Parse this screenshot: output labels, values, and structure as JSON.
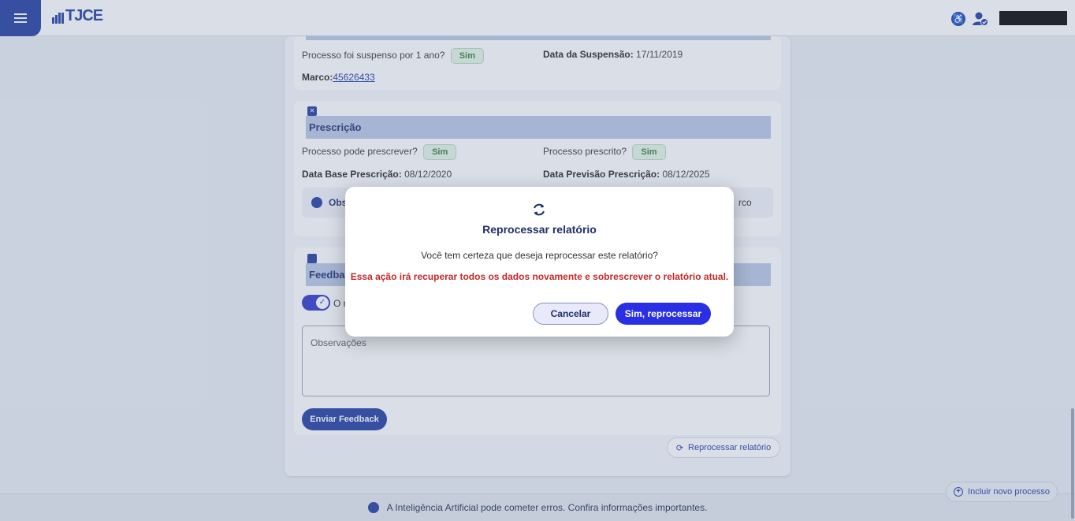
{
  "header": {
    "logo_text": "TJCE",
    "accessibility_icon": "accessibility-icon",
    "user_icon": "user-check-icon"
  },
  "suspension": {
    "suspended_label": "Processo foi suspenso por 1 ano?",
    "suspended_value": "Sim",
    "date_label": "Data da Suspensão:",
    "date_value": "17/11/2019",
    "marco_label": "Marco:",
    "marco_value": "45626433"
  },
  "prescricao": {
    "title": "Prescrição",
    "can_prescribe_label": "Processo pode prescrever?",
    "can_prescribe_value": "Sim",
    "prescribed_label": "Processo prescrito?",
    "prescribed_value": "Sim",
    "base_date_label": "Data Base Prescrição:",
    "base_date_value": "08/12/2020",
    "forecast_date_label": "Data Previsão Prescrição:",
    "forecast_date_value": "08/12/2025",
    "obs_visible_start": "Obs",
    "obs_visible_end": "rco"
  },
  "feedback": {
    "title_visible": "Feedbac",
    "toggle_text_visible": "O r",
    "observations_placeholder": "Observações",
    "send_button": "Enviar Feedback"
  },
  "reprocess_button": "Reprocessar relatório",
  "modal": {
    "title": "Reprocessar relatório",
    "message": "Você tem certeza que deseja reprocessar este relatório?",
    "warning_part1": "Essa ação irá recuperar todos os dados novamente e ",
    "warning_part2": "sobrescrever o relatório atual",
    "warning_end": ".",
    "cancel_button": "Cancelar",
    "confirm_button": "Sim, reprocessar"
  },
  "footer": {
    "disclaimer": "A Inteligência Artificial pode cometer erros. Confira informações importantes."
  },
  "fab": {
    "label": "Incluir novo processo"
  },
  "colors": {
    "primary": "#1e3a9e",
    "confirm": "#2b2fe3",
    "warning": "#c62828",
    "success": "#2e7d32"
  }
}
